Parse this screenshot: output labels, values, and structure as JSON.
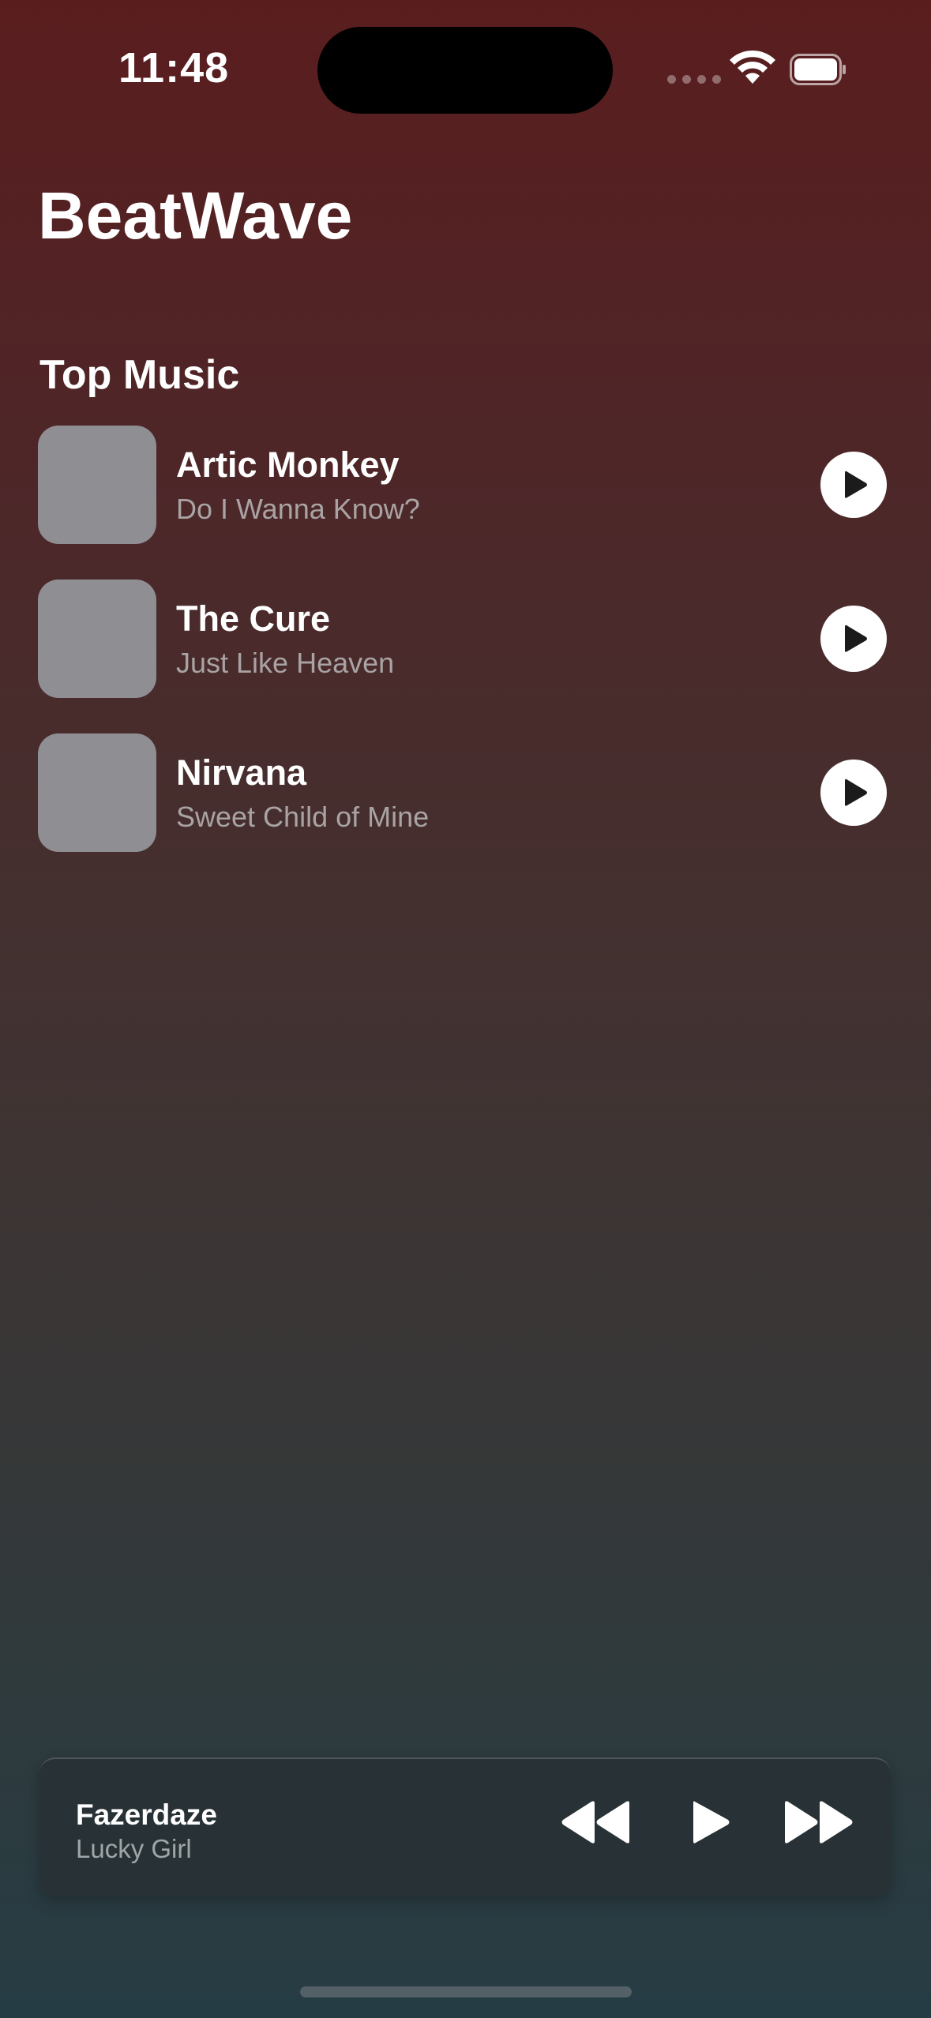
{
  "status_bar": {
    "time": "11:48"
  },
  "app": {
    "title": "BeatWave"
  },
  "section": {
    "title": "Top Music"
  },
  "tracks": [
    {
      "artist": "Artic Monkey",
      "song": "Do I Wanna Know?"
    },
    {
      "artist": "The Cure",
      "song": "Just Like Heaven"
    },
    {
      "artist": "Nirvana",
      "song": "Sweet Child of Mine"
    }
  ],
  "now_playing": {
    "artist": "Fazerdaze",
    "song": "Lucky Girl"
  },
  "icons": {
    "play": "play-icon",
    "rewind": "backward-icon",
    "forward": "forward-icon",
    "wifi": "wifi-icon",
    "battery": "battery-icon"
  },
  "colors": {
    "background_top": "#5a1d1e",
    "background_bottom": "#263c44",
    "artwork_placeholder": "#8e8e93",
    "secondary_text": "#a9a3a4"
  }
}
